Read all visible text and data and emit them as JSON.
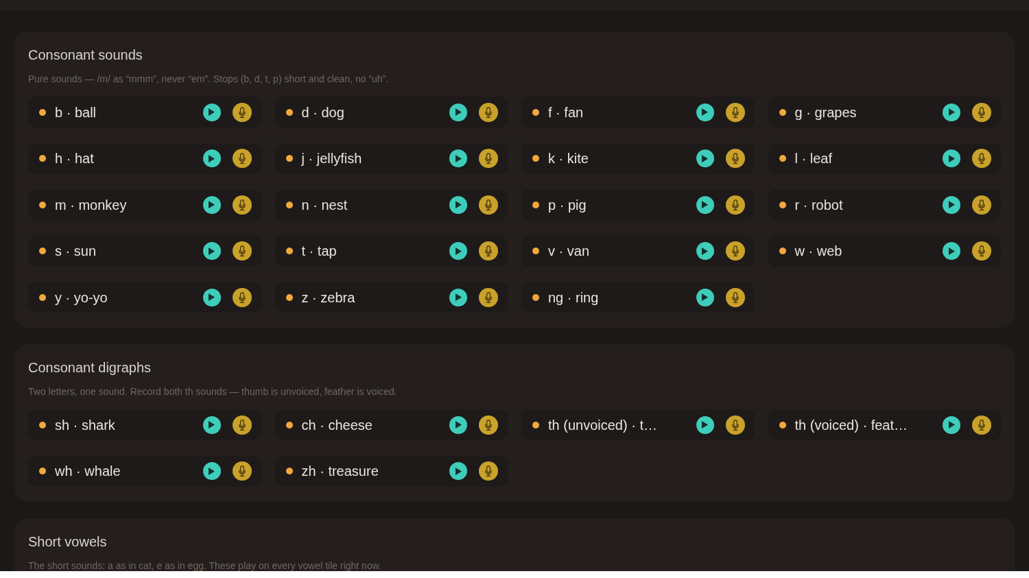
{
  "sections": [
    {
      "title": "Consonant sounds",
      "description": "Pure sounds — /m/ as “mmm”, never “em”. Stops (b, d, t, p) short and clean, no “uh”.",
      "tiles": [
        "b · ball",
        "d · dog",
        "f · fan",
        "g · grapes",
        "h · hat",
        "j · jellyfish",
        "k · kite",
        "l · leaf",
        "m · monkey",
        "n · nest",
        "p · pig",
        "r · robot",
        "s · sun",
        "t · tap",
        "v · van",
        "w · web",
        "y · yo-yo",
        "z · zebra",
        "ng · ring"
      ]
    },
    {
      "title": "Consonant digraphs",
      "description": "Two letters, one sound. Record both th sounds — thumb is unvoiced, feather is voiced.",
      "tiles": [
        "sh · shark",
        "ch · cheese",
        "th (unvoiced) · t…",
        "th (voiced) · feat…",
        "wh · whale",
        "zh · treasure"
      ]
    },
    {
      "title": "Short vowels",
      "description": "The short sounds: a as in cat, e as in egg. These play on every vowel tile right now."
    }
  ]
}
